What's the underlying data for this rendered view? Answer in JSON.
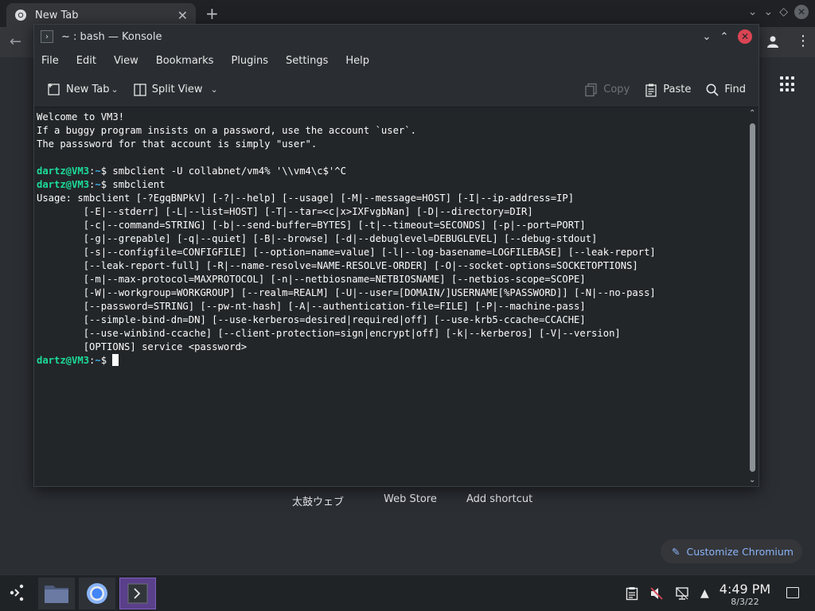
{
  "browser": {
    "tab_title": "New Tab",
    "tab_close": "✕",
    "new_tab_plus": "+",
    "shortcuts": [
      "太鼓ウェブ",
      "Web Store",
      "Add shortcut"
    ],
    "customize_label": "Customize Chromium"
  },
  "konsole": {
    "title": "~ : bash — Konsole",
    "menu": [
      "File",
      "Edit",
      "View",
      "Bookmarks",
      "Plugins",
      "Settings",
      "Help"
    ],
    "toolbar": {
      "new_tab": "New Tab",
      "split_view": "Split View",
      "copy": "Copy",
      "paste": "Paste",
      "find": "Find"
    },
    "prompt": {
      "user_host": "dartz@VM3",
      "separator": ":",
      "path": "~",
      "symbol": "$ "
    },
    "output": {
      "welcome": [
        "Welcome to VM3!",
        "If a buggy program insists on a password, use the account `user`.",
        "The passsword for that account is simply \"user\"."
      ],
      "cmd1": "smbclient -U collabnet/vm4% '\\\\vm4\\c$'^C",
      "cmd2": "smbclient",
      "usage": [
        "Usage: smbclient [-?EgqBNPkV] [-?|--help] [--usage] [-M|--message=HOST] [-I|--ip-address=IP]",
        "        [-E|--stderr] [-L|--list=HOST] [-T|--tar=<c|x>IXFvgbNan] [-D|--directory=DIR]",
        "        [-c|--command=STRING] [-b|--send-buffer=BYTES] [-t|--timeout=SECONDS] [-p|--port=PORT]",
        "        [-g|--grepable] [-q|--quiet] [-B|--browse] [-d|--debuglevel=DEBUGLEVEL] [--debug-stdout]",
        "        [-s|--configfile=CONFIGFILE] [--option=name=value] [-l|--log-basename=LOGFILEBASE] [--leak-report]",
        "        [--leak-report-full] [-R|--name-resolve=NAME-RESOLVE-ORDER] [-O|--socket-options=SOCKETOPTIONS]",
        "        [-m|--max-protocol=MAXPROTOCOL] [-n|--netbiosname=NETBIOSNAME] [--netbios-scope=SCOPE]",
        "        [-W|--workgroup=WORKGROUP] [--realm=REALM] [-U|--user=[DOMAIN/]USERNAME[%PASSWORD]] [-N|--no-pass]",
        "        [--password=STRING] [--pw-nt-hash] [-A|--authentication-file=FILE] [-P|--machine-pass]",
        "        [--simple-bind-dn=DN] [--use-kerberos=desired|required|off] [--use-krb5-ccache=CCACHE]",
        "        [--use-winbind-ccache] [--client-protection=sign|encrypt|off] [-k|--kerberos] [-V|--version]",
        "        [OPTIONS] service <password>"
      ]
    }
  },
  "taskbar": {
    "time": "4:49 PM",
    "date": "8/3/22"
  },
  "colors": {
    "prompt_user": "#1cdc9a",
    "prompt_path": "#3daee9",
    "konsole_bg": "#232629",
    "close_button": "#da4453",
    "active_task": "#5a3f8a"
  }
}
